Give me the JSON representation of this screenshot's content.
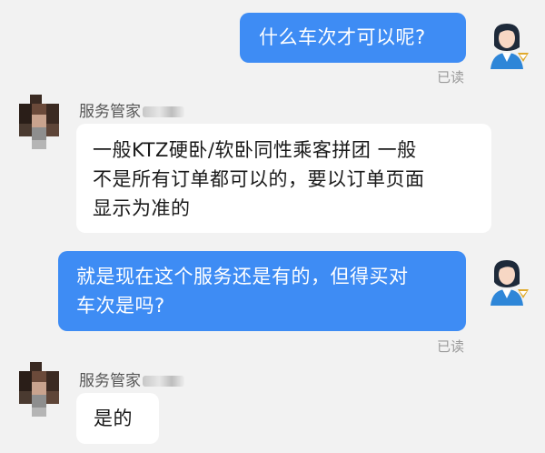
{
  "messages": [
    {
      "sender": "self",
      "text": "什么车次才可以呢?",
      "status": "已读"
    },
    {
      "sender": "agent",
      "name": "服务管家",
      "text_lines": [
        "一般KTZ硬卧/软卧同性乘客拼团 一般",
        "不是所有订单都可以的，要以订单页面",
        "显示为准的"
      ]
    },
    {
      "sender": "self",
      "text_lines": [
        "就是现在这个服务还是有的，但得买对",
        "车次是吗?"
      ],
      "status": "已读"
    },
    {
      "sender": "agent",
      "name": "服务管家",
      "text": "是的"
    }
  ],
  "colors": {
    "outgoing_bubble": "#3e8cf4",
    "incoming_bubble": "#ffffff",
    "background": "#f2f2f2"
  },
  "icons": {
    "self_avatar": "woman-avatar-icon",
    "agent_avatar": "pixelated-avatar"
  }
}
